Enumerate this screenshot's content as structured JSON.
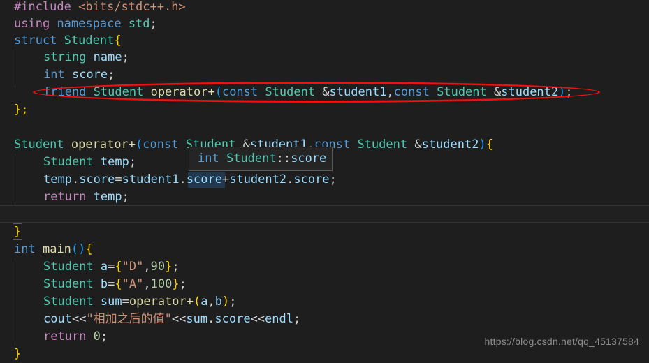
{
  "app": {
    "kind": "code-editor",
    "theme": "dark-plus",
    "background": "#1e1e1e",
    "foreground": "#d4d4d4",
    "font_size_px": 17,
    "line_height_px": 25
  },
  "colors": {
    "preprocessor": "#c586c0",
    "string": "#ce9178",
    "keyword": "#569cd6",
    "type": "#4ec9b0",
    "variable": "#9cdcfe",
    "function": "#dcdcaa",
    "number": "#b5cea8",
    "punctuation": "#d4d4d4",
    "control": "#c586c0",
    "annotation_red": "#ee1111",
    "selection_blue": "#264f78",
    "tooltip_bg": "#252526",
    "tooltip_border": "#585858",
    "indent_guide": "#404040",
    "current_line_border": "#333639",
    "watermark": "#8d8d8d"
  },
  "code": {
    "language": "cpp",
    "lines": [
      {
        "n": 1,
        "text": "#include <bits/stdc++.h>"
      },
      {
        "n": 2,
        "text": "using namespace std;"
      },
      {
        "n": 3,
        "text": "struct Student{"
      },
      {
        "n": 4,
        "text": "    string name;"
      },
      {
        "n": 5,
        "text": "    int score;"
      },
      {
        "n": 6,
        "text": "    friend Student operator+(const Student &student1,const Student &student2);"
      },
      {
        "n": 7,
        "text": "};"
      },
      {
        "n": 8,
        "text": ""
      },
      {
        "n": 9,
        "text": "Student operator+(const Student &student1,const Student &student2){"
      },
      {
        "n": 10,
        "text": "    Student temp;"
      },
      {
        "n": 11,
        "text": "    temp.score=student1.score+student2.score;"
      },
      {
        "n": 12,
        "text": "    return temp;"
      },
      {
        "n": 13,
        "text": ""
      },
      {
        "n": 14,
        "text": "}"
      },
      {
        "n": 15,
        "text": "int main(){"
      },
      {
        "n": 16,
        "text": "    Student a={\"D\",90};"
      },
      {
        "n": 17,
        "text": "    Student b={\"A\",100};"
      },
      {
        "n": 18,
        "text": "    Student sum=operator+(a,b);"
      },
      {
        "n": 19,
        "text": "    cout<<\"相加之后的值\"<<sum.score<<endl;"
      },
      {
        "n": 20,
        "text": "    return 0;"
      },
      {
        "n": 21,
        "text": "}"
      }
    ]
  },
  "tokens": {
    "l1": {
      "a": "#include",
      "b": " ",
      "c": "<bits/stdc++.h>"
    },
    "l2": {
      "a": "using",
      "b": " ",
      "c": "namespace",
      "d": " ",
      "e": "std",
      "f": ";"
    },
    "l3": {
      "a": "struct",
      "b": " ",
      "c": "Student",
      "d": "{"
    },
    "l4": {
      "a": "string",
      "b": " ",
      "c": "name",
      "d": ";"
    },
    "l5": {
      "a": "int",
      "b": " ",
      "c": "score",
      "d": ";"
    },
    "l6": {
      "a": "friend",
      "b": " ",
      "c": "Student",
      "d": " ",
      "e": "operator+",
      "f": "(",
      "g": "const",
      "h": " ",
      "i": "Student",
      "j": " &",
      "k": "student1",
      "l": ",",
      "m": "const",
      "n": " ",
      "o": "Student",
      "p": " &",
      "q": "student2",
      "r": ")",
      "s": ";"
    },
    "l7": {
      "a": "};"
    },
    "l9": {
      "a": "Student",
      "b": " ",
      "c": "operator+",
      "d": "(",
      "e": "const",
      "f": " ",
      "g": "Student",
      "h": " &",
      "i": "student1",
      "j": ",",
      "k": "const",
      "l": " ",
      "m": "Student",
      "n": " &",
      "o": "student2",
      "p": ")",
      "q": "{"
    },
    "l10": {
      "a": "Student",
      "b": " ",
      "c": "temp",
      "d": ";"
    },
    "l11": {
      "a": "temp",
      "b": ".",
      "c": "score",
      "d": "=",
      "e": "student1",
      "f": ".",
      "g": "score",
      "h": "+",
      "i": "student2",
      "j": ".",
      "k": "score",
      "l": ";"
    },
    "l12": {
      "a": "return",
      "b": " ",
      "c": "temp",
      "d": ";"
    },
    "l14": {
      "a": "}"
    },
    "l15": {
      "a": "int",
      "b": " ",
      "c": "main",
      "d": "(",
      "e": ")",
      "f": "{"
    },
    "l16": {
      "a": "Student",
      "b": " ",
      "c": "a",
      "d": "=",
      "e": "{",
      "f": "\"D\"",
      "g": ",",
      "h": "90",
      "i": "}",
      "j": ";"
    },
    "l17": {
      "a": "Student",
      "b": " ",
      "c": "b",
      "d": "=",
      "e": "{",
      "f": "\"A\"",
      "g": ",",
      "h": "100",
      "i": "}",
      "j": ";"
    },
    "l18": {
      "a": "Student",
      "b": " ",
      "c": "sum",
      "d": "=",
      "e": "operator+",
      "f": "(",
      "g": "a",
      "h": ",",
      "i": "b",
      "j": ")",
      "k": ";"
    },
    "l19": {
      "a": "cout",
      "b": "<<",
      "c": "\"相加之后的值\"",
      "d": "<<",
      "e": "sum",
      "f": ".",
      "g": "score",
      "h": "<<",
      "i": "endl",
      "j": ";"
    },
    "l20": {
      "a": "return",
      "b": " ",
      "c": "0",
      "d": ";"
    },
    "l21": {
      "a": "}"
    }
  },
  "hover_tooltip": {
    "visible": true,
    "kind": "member-type-hint",
    "type_keyword": "int",
    "space": " ",
    "owner": "Student",
    "scope_operator": "::",
    "member": "score",
    "full_text": "int Student::score"
  },
  "annotation": {
    "shape": "ellipse",
    "color": "#ee1111",
    "targets_line": 6,
    "target_text": "friend Student operator+(const Student &student1,const Student &student2);"
  },
  "selection": {
    "highlighted_word": "score",
    "on_line": 11
  },
  "current_line": {
    "line_number": 13,
    "is_empty": true
  },
  "bracket_match": {
    "character": "}",
    "line_number": 14
  },
  "watermark": {
    "text": "https://blog.csdn.net/qq_45137584"
  }
}
